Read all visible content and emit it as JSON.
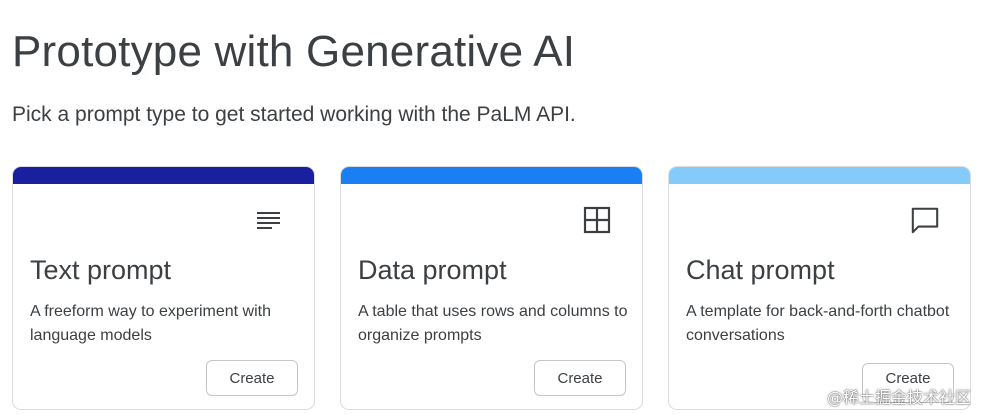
{
  "page": {
    "title": "Prototype with Generative AI",
    "subtitle": "Pick a prompt type to get started working with the PaLM API."
  },
  "cards": [
    {
      "title": "Text prompt",
      "description": "A freeform way to experiment with language models",
      "button_label": "Create",
      "icon": "notes-lines-icon",
      "accent_color": "#1a1fa0"
    },
    {
      "title": "Data prompt",
      "description": "A table that uses rows and columns to organize prompts",
      "button_label": "Create",
      "icon": "table-grid-icon",
      "accent_color": "#1a7ff2"
    },
    {
      "title": "Chat prompt",
      "description": "A template for back-and-forth chatbot conversations",
      "button_label": "Create",
      "icon": "chat-bubble-icon",
      "accent_color": "#85cbf9"
    }
  ],
  "watermark": {
    "text": "@稀土掘金技术社区"
  }
}
